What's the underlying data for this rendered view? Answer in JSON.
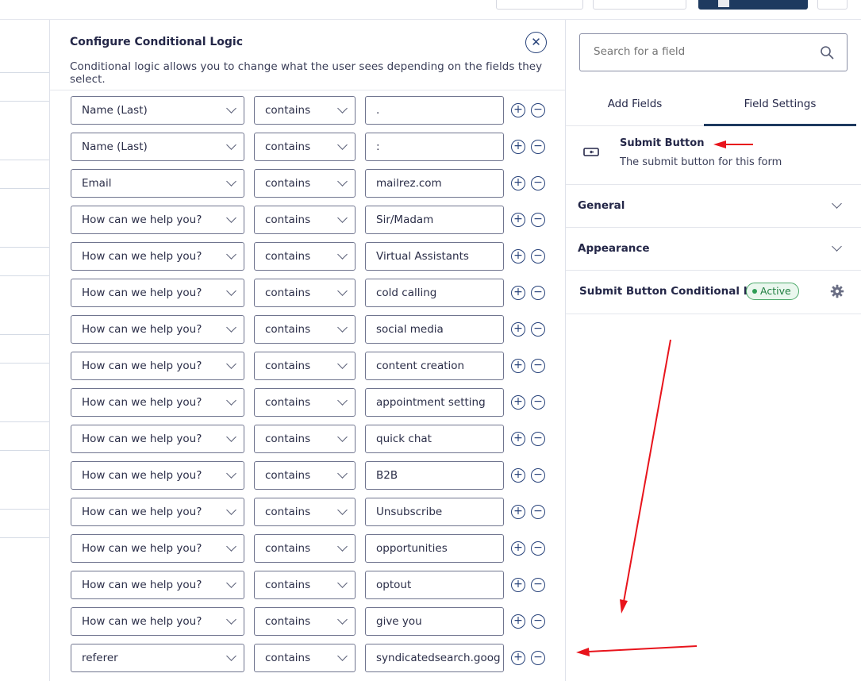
{
  "modal": {
    "title": "Configure Conditional Logic",
    "description": "Conditional logic allows you to change what the user sees depending on the fields they select.",
    "close_icon": "close-icon",
    "rules": [
      {
        "field": "Name (Last)",
        "operator": "contains",
        "value": "."
      },
      {
        "field": "Name (Last)",
        "operator": "contains",
        "value": ":"
      },
      {
        "field": "Email",
        "operator": "contains",
        "value": "mailrez.com"
      },
      {
        "field": "How can we help you?",
        "operator": "contains",
        "value": "Sir/Madam"
      },
      {
        "field": "How can we help you?",
        "operator": "contains",
        "value": "Virtual Assistants"
      },
      {
        "field": "How can we help you?",
        "operator": "contains",
        "value": "cold calling"
      },
      {
        "field": "How can we help you?",
        "operator": "contains",
        "value": "social media"
      },
      {
        "field": "How can we help you?",
        "operator": "contains",
        "value": "content creation"
      },
      {
        "field": "How can we help you?",
        "operator": "contains",
        "value": "appointment setting"
      },
      {
        "field": "How can we help you?",
        "operator": "contains",
        "value": "quick chat"
      },
      {
        "field": "How can we help you?",
        "operator": "contains",
        "value": "B2B"
      },
      {
        "field": "How can we help you?",
        "operator": "contains",
        "value": "Unsubscribe"
      },
      {
        "field": "How can we help you?",
        "operator": "contains",
        "value": "opportunities"
      },
      {
        "field": "How can we help you?",
        "operator": "contains",
        "value": "optout"
      },
      {
        "field": "How can we help you?",
        "operator": "contains",
        "value": "give you"
      },
      {
        "field": "referer",
        "operator": "contains",
        "value": "syndicatedsearch.goog"
      }
    ]
  },
  "sidebar": {
    "search_placeholder": "Search for a field",
    "search_icon": "search-icon",
    "tabs": [
      {
        "label": "Add Fields",
        "active": false
      },
      {
        "label": "Field Settings",
        "active": true
      }
    ],
    "field": {
      "icon": "submit-button-icon",
      "name": "Submit Button",
      "description": "The submit button for this form"
    },
    "sections": [
      {
        "label": "General"
      },
      {
        "label": "Appearance"
      }
    ],
    "conditional_logic": {
      "label": "Submit Button Conditional Logic",
      "badge": "Active",
      "icon": "gear-icon"
    }
  },
  "colors": {
    "accent": "#1e3a5f",
    "active_badge": "#2e9d55",
    "annotation_arrow": "#e8141c"
  }
}
